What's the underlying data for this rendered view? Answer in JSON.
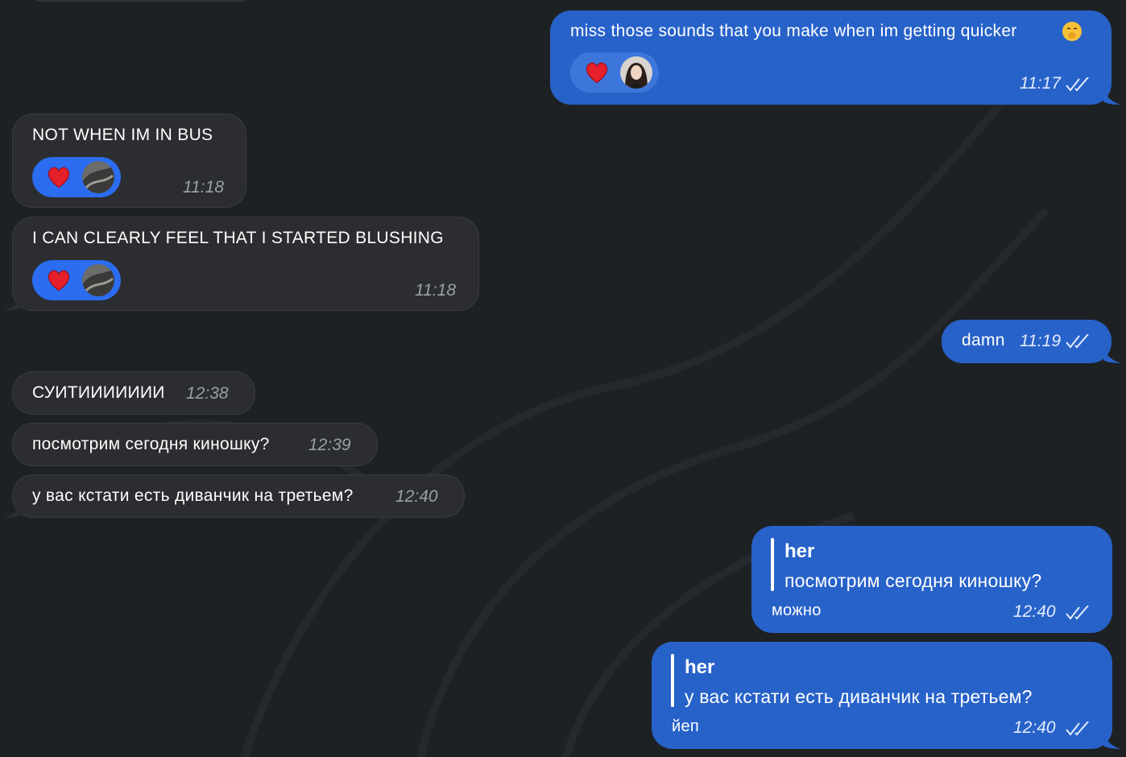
{
  "colors": {
    "background": "#1e2124",
    "incoming_bubble": "#2b2d30",
    "outgoing_bubble": "#2762c9",
    "reaction_incoming": "#2b6cf0"
  },
  "messages": [
    {
      "text": "miss those sounds that you make when im getting quicker",
      "emoji": "face-with-hand-over-mouth",
      "reaction": "heart",
      "time": "11:17"
    },
    {
      "text": "NOT WHEN IM IN BUS",
      "reaction": "heart",
      "time": "11:18"
    },
    {
      "text": "I CAN CLEARLY FEEL THAT I STARTED BLUSHING",
      "reaction": "heart",
      "time": "11:18"
    },
    {
      "text": "damn",
      "time": "11:19"
    },
    {
      "text": "СУИТИИИИИИИ",
      "time": "12:38"
    },
    {
      "text": "посмотрим сегодня киношку?",
      "time": "12:39"
    },
    {
      "text": "у вас кстати есть диванчик на третьем?",
      "time": "12:40"
    },
    {
      "reply_name": "her",
      "reply_text": "посмотрим сегодня киношку?",
      "text": "можно",
      "time": "12:40"
    },
    {
      "reply_name": "her",
      "reply_text": "у вас кстати есть диванчик на третьем?",
      "text": "йеп",
      "time": "12:40"
    }
  ]
}
